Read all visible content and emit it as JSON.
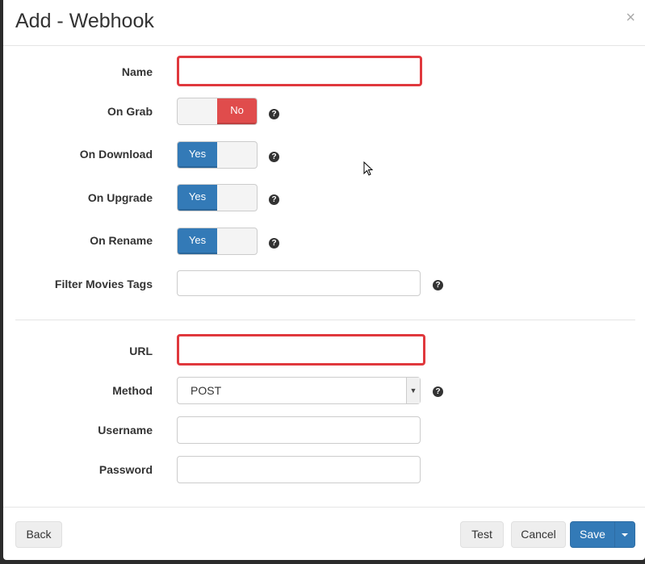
{
  "modal": {
    "title": "Add - Webhook",
    "close_glyph": "×"
  },
  "fields": {
    "name": {
      "label": "Name",
      "value": ""
    },
    "on_grab": {
      "label": "On Grab",
      "value": "No"
    },
    "on_download": {
      "label": "On Download",
      "value": "Yes"
    },
    "on_upgrade": {
      "label": "On Upgrade",
      "value": "Yes"
    },
    "on_rename": {
      "label": "On Rename",
      "value": "Yes"
    },
    "filter_tags": {
      "label": "Filter Movies Tags",
      "value": ""
    },
    "url": {
      "label": "URL",
      "value": ""
    },
    "method": {
      "label": "Method",
      "value": "POST"
    },
    "username": {
      "label": "Username",
      "value": ""
    },
    "password": {
      "label": "Password",
      "value": ""
    }
  },
  "help_glyph": "?",
  "buttons": {
    "back": "Back",
    "test": "Test",
    "cancel": "Cancel",
    "save": "Save"
  },
  "colors": {
    "primary": "#337ab7",
    "danger": "#e04c4c",
    "error_border": "#e0383d"
  }
}
